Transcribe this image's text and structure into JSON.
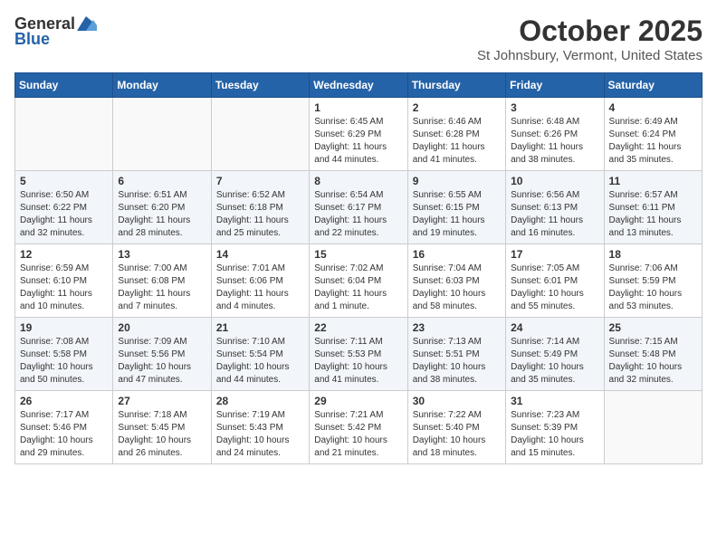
{
  "header": {
    "logo_general": "General",
    "logo_blue": "Blue",
    "month_title": "October 2025",
    "location": "St Johnsbury, Vermont, United States"
  },
  "days_of_week": [
    "Sunday",
    "Monday",
    "Tuesday",
    "Wednesday",
    "Thursday",
    "Friday",
    "Saturday"
  ],
  "weeks": [
    [
      {
        "day": "",
        "info": ""
      },
      {
        "day": "",
        "info": ""
      },
      {
        "day": "",
        "info": ""
      },
      {
        "day": "1",
        "info": "Sunrise: 6:45 AM\nSunset: 6:29 PM\nDaylight: 11 hours\nand 44 minutes."
      },
      {
        "day": "2",
        "info": "Sunrise: 6:46 AM\nSunset: 6:28 PM\nDaylight: 11 hours\nand 41 minutes."
      },
      {
        "day": "3",
        "info": "Sunrise: 6:48 AM\nSunset: 6:26 PM\nDaylight: 11 hours\nand 38 minutes."
      },
      {
        "day": "4",
        "info": "Sunrise: 6:49 AM\nSunset: 6:24 PM\nDaylight: 11 hours\nand 35 minutes."
      }
    ],
    [
      {
        "day": "5",
        "info": "Sunrise: 6:50 AM\nSunset: 6:22 PM\nDaylight: 11 hours\nand 32 minutes."
      },
      {
        "day": "6",
        "info": "Sunrise: 6:51 AM\nSunset: 6:20 PM\nDaylight: 11 hours\nand 28 minutes."
      },
      {
        "day": "7",
        "info": "Sunrise: 6:52 AM\nSunset: 6:18 PM\nDaylight: 11 hours\nand 25 minutes."
      },
      {
        "day": "8",
        "info": "Sunrise: 6:54 AM\nSunset: 6:17 PM\nDaylight: 11 hours\nand 22 minutes."
      },
      {
        "day": "9",
        "info": "Sunrise: 6:55 AM\nSunset: 6:15 PM\nDaylight: 11 hours\nand 19 minutes."
      },
      {
        "day": "10",
        "info": "Sunrise: 6:56 AM\nSunset: 6:13 PM\nDaylight: 11 hours\nand 16 minutes."
      },
      {
        "day": "11",
        "info": "Sunrise: 6:57 AM\nSunset: 6:11 PM\nDaylight: 11 hours\nand 13 minutes."
      }
    ],
    [
      {
        "day": "12",
        "info": "Sunrise: 6:59 AM\nSunset: 6:10 PM\nDaylight: 11 hours\nand 10 minutes."
      },
      {
        "day": "13",
        "info": "Sunrise: 7:00 AM\nSunset: 6:08 PM\nDaylight: 11 hours\nand 7 minutes."
      },
      {
        "day": "14",
        "info": "Sunrise: 7:01 AM\nSunset: 6:06 PM\nDaylight: 11 hours\nand 4 minutes."
      },
      {
        "day": "15",
        "info": "Sunrise: 7:02 AM\nSunset: 6:04 PM\nDaylight: 11 hours\nand 1 minute."
      },
      {
        "day": "16",
        "info": "Sunrise: 7:04 AM\nSunset: 6:03 PM\nDaylight: 10 hours\nand 58 minutes."
      },
      {
        "day": "17",
        "info": "Sunrise: 7:05 AM\nSunset: 6:01 PM\nDaylight: 10 hours\nand 55 minutes."
      },
      {
        "day": "18",
        "info": "Sunrise: 7:06 AM\nSunset: 5:59 PM\nDaylight: 10 hours\nand 53 minutes."
      }
    ],
    [
      {
        "day": "19",
        "info": "Sunrise: 7:08 AM\nSunset: 5:58 PM\nDaylight: 10 hours\nand 50 minutes."
      },
      {
        "day": "20",
        "info": "Sunrise: 7:09 AM\nSunset: 5:56 PM\nDaylight: 10 hours\nand 47 minutes."
      },
      {
        "day": "21",
        "info": "Sunrise: 7:10 AM\nSunset: 5:54 PM\nDaylight: 10 hours\nand 44 minutes."
      },
      {
        "day": "22",
        "info": "Sunrise: 7:11 AM\nSunset: 5:53 PM\nDaylight: 10 hours\nand 41 minutes."
      },
      {
        "day": "23",
        "info": "Sunrise: 7:13 AM\nSunset: 5:51 PM\nDaylight: 10 hours\nand 38 minutes."
      },
      {
        "day": "24",
        "info": "Sunrise: 7:14 AM\nSunset: 5:49 PM\nDaylight: 10 hours\nand 35 minutes."
      },
      {
        "day": "25",
        "info": "Sunrise: 7:15 AM\nSunset: 5:48 PM\nDaylight: 10 hours\nand 32 minutes."
      }
    ],
    [
      {
        "day": "26",
        "info": "Sunrise: 7:17 AM\nSunset: 5:46 PM\nDaylight: 10 hours\nand 29 minutes."
      },
      {
        "day": "27",
        "info": "Sunrise: 7:18 AM\nSunset: 5:45 PM\nDaylight: 10 hours\nand 26 minutes."
      },
      {
        "day": "28",
        "info": "Sunrise: 7:19 AM\nSunset: 5:43 PM\nDaylight: 10 hours\nand 24 minutes."
      },
      {
        "day": "29",
        "info": "Sunrise: 7:21 AM\nSunset: 5:42 PM\nDaylight: 10 hours\nand 21 minutes."
      },
      {
        "day": "30",
        "info": "Sunrise: 7:22 AM\nSunset: 5:40 PM\nDaylight: 10 hours\nand 18 minutes."
      },
      {
        "day": "31",
        "info": "Sunrise: 7:23 AM\nSunset: 5:39 PM\nDaylight: 10 hours\nand 15 minutes."
      },
      {
        "day": "",
        "info": ""
      }
    ]
  ]
}
